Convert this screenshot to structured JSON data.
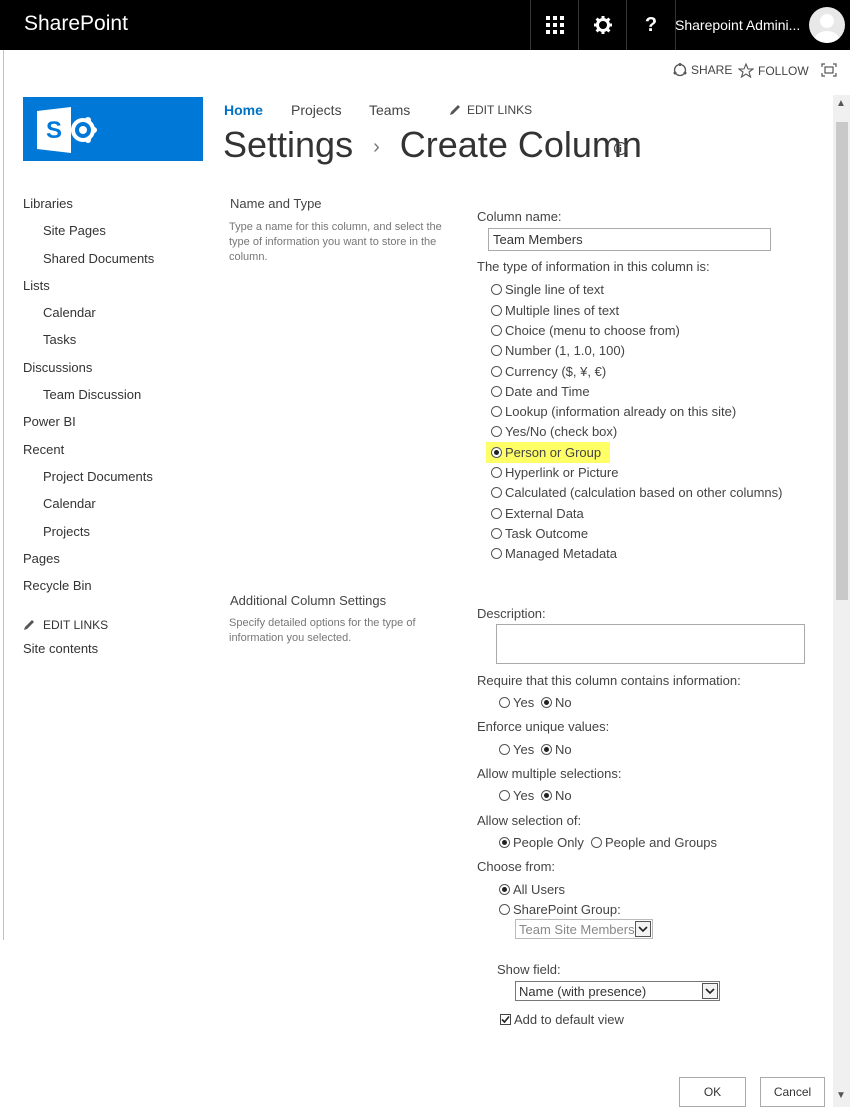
{
  "topbar": {
    "brand": "SharePoint",
    "user_name": "Sharepoint Admini...",
    "icons": [
      "app-launcher-icon",
      "gear-icon",
      "help-icon",
      "avatar"
    ]
  },
  "suitebar": {
    "share_label": "SHARE",
    "follow_label": "FOLLOW",
    "icons": [
      "share-icon",
      "star-icon",
      "focus-icon"
    ]
  },
  "topnav": {
    "home": "Home",
    "projects": "Projects",
    "teams": "Teams",
    "edit_links": "EDIT LINKS"
  },
  "title": {
    "part1": "Settings",
    "separator": "›",
    "part2": "Create Column",
    "info_icon": "info-icon"
  },
  "leftnav": {
    "libraries": "Libraries",
    "site_pages": "Site Pages",
    "shared_documents": "Shared Documents",
    "lists": "Lists",
    "calendar": "Calendar",
    "tasks": "Tasks",
    "discussions": "Discussions",
    "team_discussion": "Team Discussion",
    "power_bi": "Power BI",
    "recent": "Recent",
    "project_documents": "Project Documents",
    "recent_calendar": "Calendar",
    "recent_projects": "Projects",
    "pages": "Pages",
    "recycle_bin": "Recycle Bin",
    "edit_links": "EDIT LINKS",
    "site_contents": "Site contents"
  },
  "section1": {
    "title": "Name and Type",
    "desc": "Type a name for this column, and select the type of information you want to store in the column."
  },
  "section2": {
    "title": "Additional Column Settings",
    "desc": "Specify detailed options for the type of information you selected."
  },
  "form": {
    "column_name_label": "Column name:",
    "column_name_value": "Team Members",
    "type_label": "The type of information in this column is:",
    "types": [
      "Single line of text",
      "Multiple lines of text",
      "Choice (menu to choose from)",
      "Number (1, 1.0, 100)",
      "Currency ($, ¥, €)",
      "Date and Time",
      "Lookup (information already on this site)",
      "Yes/No (check box)",
      "Person or Group",
      "Hyperlink or Picture",
      "Calculated (calculation based on other columns)",
      "External Data",
      "Task Outcome",
      "Managed Metadata"
    ],
    "selected_type": "Person or Group",
    "highlight_color": "#ffff66",
    "description_label": "Description:",
    "require_label": "Require that this column contains information:",
    "unique_label": "Enforce unique values:",
    "multiple_label": "Allow multiple selections:",
    "yes": "Yes",
    "no": "No",
    "allow_selection_label": "Allow selection of:",
    "people_only": "People Only",
    "people_and_groups": "People and Groups",
    "choose_from_label": "Choose from:",
    "all_users": "All Users",
    "sharepoint_group": "SharePoint Group:",
    "group_select_value": "Team Site Members",
    "show_field_label": "Show field:",
    "show_field_value": "Name (with presence)",
    "add_default_view": "Add to default view",
    "add_default_view_checked": true
  },
  "buttons": {
    "ok": "OK",
    "cancel": "Cancel"
  },
  "colors": {
    "brand_blue": "#0078d7",
    "link_blue": "#0072c6",
    "topbar": "#000000"
  }
}
